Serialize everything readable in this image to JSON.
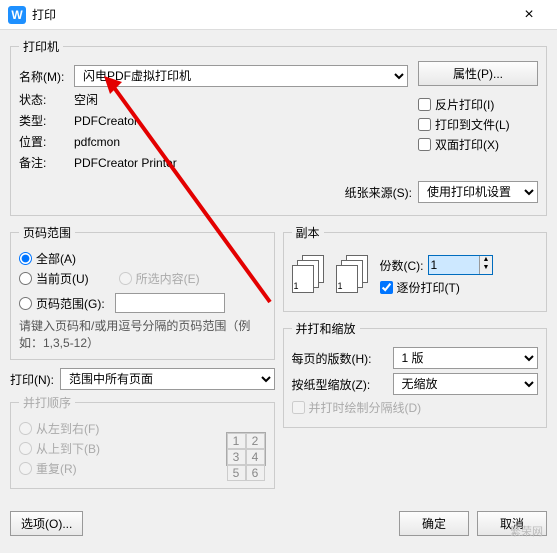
{
  "window": {
    "title": "打印"
  },
  "printer": {
    "group": "打印机",
    "name_label": "名称(M):",
    "name_value": "闪电PDF虚拟打印机",
    "properties_btn": "属性(P)...",
    "status_label": "状态:",
    "status_value": "空闲",
    "type_label": "类型:",
    "type_value": "PDFCreator",
    "location_label": "位置:",
    "location_value": "pdfcmon",
    "comment_label": "备注:",
    "comment_value": "PDFCreator Printer",
    "reverse_print": "反片打印(I)",
    "print_to_file": "打印到文件(L)",
    "duplex": "双面打印(X)",
    "paper_source_label": "纸张来源(S):",
    "paper_source_value": "使用打印机设置"
  },
  "pages": {
    "group": "页码范围",
    "all": "全部(A)",
    "current": "当前页(U)",
    "selection": "所选内容(E)",
    "range": "页码范围(G):",
    "hint": "请键入页码和/或用逗号分隔的页码范围（例如：1,3,5-12）"
  },
  "copies": {
    "group": "副本",
    "count_label": "份数(C):",
    "count_value": "1",
    "collate": "逐份打印(T)"
  },
  "print_what": {
    "label": "打印(N):",
    "value": "范围中所有页面"
  },
  "order": {
    "group": "并打顺序",
    "lr": "从左到右(F)",
    "tb": "从上到下(B)",
    "repeat": "重复(R)"
  },
  "scale": {
    "group": "并打和缩放",
    "per_sheet_label": "每页的版数(H):",
    "per_sheet_value": "1 版",
    "scale_label": "按纸型缩放(Z):",
    "scale_value": "无缩放",
    "sep_line": "并打时绘制分隔线(D)"
  },
  "footer": {
    "options": "选项(O)...",
    "ok": "确定",
    "cancel": "取消"
  },
  "watermark": "繁荣网"
}
